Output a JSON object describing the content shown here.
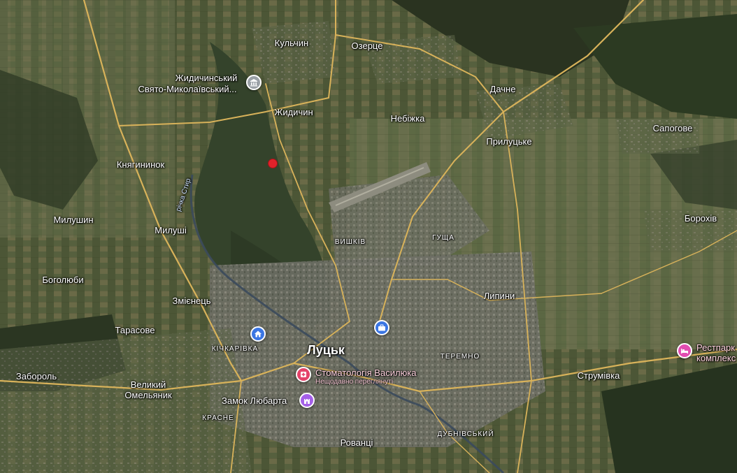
{
  "map": {
    "view": "satellite",
    "places": {
      "kulchyn": "Кульчин",
      "ozertse": "Озерце",
      "zhydychynskyi": "Жидичинський",
      "sviato": "Свято-Миколаївський...",
      "zhydychyn": "Жидичин",
      "nebizhka": "Небіжка",
      "dachne": "Дачне",
      "prylutske": "Прилуцьке",
      "sapohove": "Сапогове",
      "knyahyninok": "Княгининок",
      "milushyn": "Милушин",
      "milushi": "Милуші",
      "vyshkiv": "ВИШКІВ",
      "hushcha": "ГУЩА",
      "borokhiv": "Борохів",
      "bohoboliubi": "Боголюби",
      "zmiinets": "Змієнець",
      "lypyny": "Липини",
      "tarasove": "Тарасове",
      "kichkarivka": "КІЧКАРІВКА",
      "lutsk": "Луцьк",
      "teremno": "ТЕРЕМНО",
      "zaborol": "Забороль",
      "velykyi": "Великий",
      "omeliannyk": "Омельяник",
      "strumivka": "Струмівка",
      "krasne": "КРАСНЕ",
      "rovantsi": "Рованці",
      "dubnivskyi": "ДУБНІВСЬКИЙ"
    },
    "river": "річка Стир",
    "pois": {
      "dental_name": "Стоматологія Василюка",
      "dental_sub": "Нещодавно переглянуті",
      "castle": "Замок Любарта",
      "resort_line1": "Рестпарк",
      "resort_line2": "комплекс"
    },
    "colors": {
      "poi_pink": "#e4446a",
      "poi_blue": "#3b76e3",
      "poi_purple": "#a560e8",
      "poi_gray": "#9aa0a6",
      "poi_magenta": "#e24db1",
      "marker_red": "#e0222a",
      "road": "#d8b25a"
    },
    "icons": {
      "monastery": "monastery-icon",
      "hotel": "home-icon",
      "work": "briefcase-icon",
      "dental": "tooth-icon",
      "castle": "castle-icon",
      "resort": "bed-icon",
      "marker": "red-dot-marker"
    }
  }
}
